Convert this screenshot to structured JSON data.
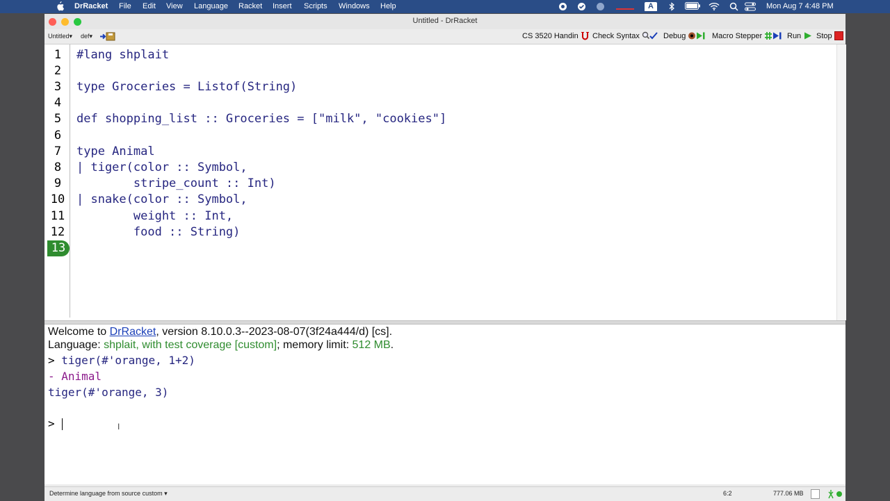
{
  "menubar": {
    "app": "DrRacket",
    "items": [
      "File",
      "Edit",
      "View",
      "Language",
      "Racket",
      "Insert",
      "Scripts",
      "Windows",
      "Help"
    ],
    "clock": "Mon Aug 7  4:48 PM",
    "input_badge": "A"
  },
  "window": {
    "title": "Untitled - DrRacket"
  },
  "toolbar": {
    "file_menu": "Untitled▾",
    "def_menu": "def▾",
    "handin": "CS 3520 Handin",
    "check_syntax": "Check Syntax",
    "debug": "Debug",
    "macro_stepper": "Macro Stepper",
    "run": "Run",
    "stop": "Stop"
  },
  "editor": {
    "line_numbers": [
      "1",
      "2",
      "3",
      "4",
      "5",
      "6",
      "7",
      "8",
      "9",
      "10",
      "11",
      "12",
      "13"
    ],
    "lines": [
      "#lang shplait",
      "",
      "type Groceries = Listof(String)",
      "",
      "def shopping_list :: Groceries = [\"milk\", \"cookies\"]",
      "",
      "type Animal",
      "| tiger(color :: Symbol,",
      "        stripe_count :: Int)",
      "| snake(color :: Symbol,",
      "        weight :: Int,",
      "        food :: String)",
      ""
    ]
  },
  "repl": {
    "welcome_prefix": "Welcome to ",
    "welcome_link": "DrRacket",
    "welcome_suffix": ", version 8.10.0.3--2023-08-07(3f24a444/d) [cs].",
    "language_prefix": "Language: ",
    "language_name": "shplait, with test coverage [custom]",
    "language_mid": "; memory limit: ",
    "memory_limit": "512 MB",
    "language_end": ".",
    "prompt": ">",
    "input1": "tiger(#'orange, 1+2)",
    "type_line": "- Animal",
    "result1": "tiger(#'orange, 3)"
  },
  "status": {
    "language": "Determine language from source custom ▾",
    "position": "6:2",
    "memory": "777.06 MB"
  }
}
